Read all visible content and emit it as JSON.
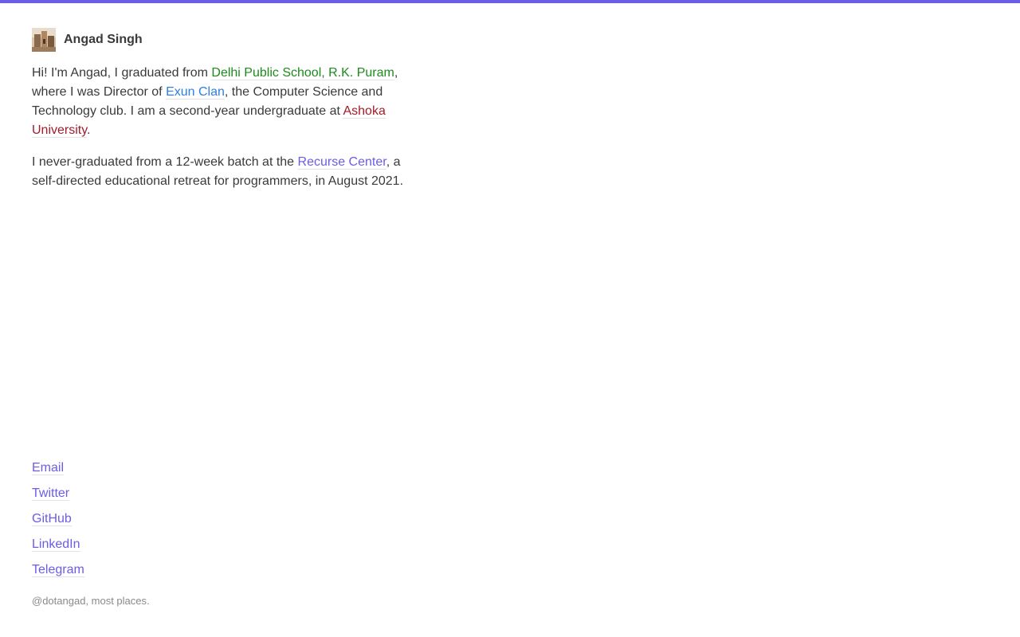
{
  "colors": {
    "accent": "#6c5ce7",
    "dps": "#1e8a1e",
    "exun": "#2f7fe0",
    "ashoka": "#a11d2a",
    "text": "#3a3a3a",
    "muted": "#8a8a8a"
  },
  "header": {
    "name": "Angad Singh"
  },
  "intro": {
    "p1_a": "Hi! I'm Angad, I graduated from ",
    "p1_link_school": "Delhi Public School, R.K. Puram",
    "p1_b": ", where I was Director of ",
    "p1_link_club": "Exun Clan",
    "p1_c": ", the Computer Science and Technology club. I am a second-year undergraduate at ",
    "p1_link_uni": "Ashoka University",
    "p1_d": ".",
    "p2_a": "I never-graduated from a 12-week batch at the ",
    "p2_link_rc": "Recurse Center",
    "p2_b": ", a self-directed educational retreat for programmers, in August 2021."
  },
  "social": {
    "email": "Email",
    "twitter": "Twitter",
    "github": "GitHub",
    "linkedin": "LinkedIn",
    "telegram": "Telegram"
  },
  "handle": "@dotangad, most places."
}
